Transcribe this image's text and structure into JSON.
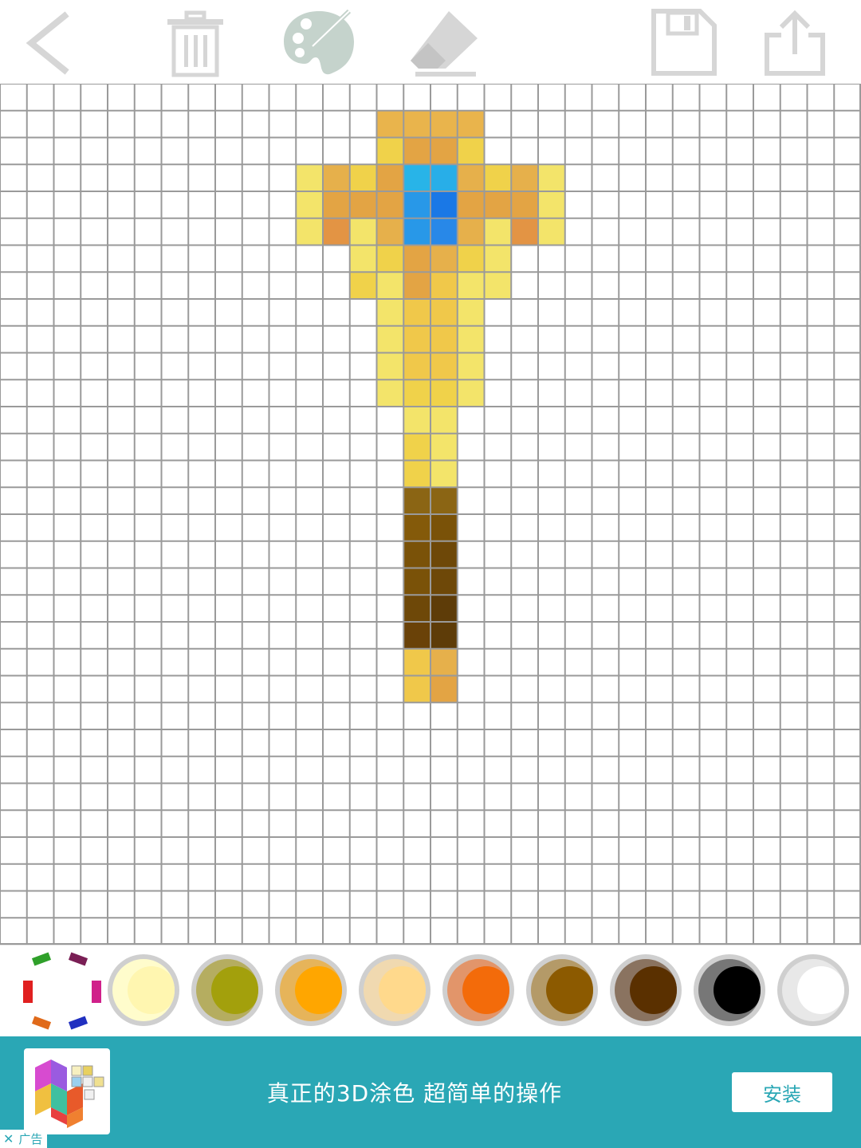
{
  "toolbar": {
    "icons": [
      "back-arrow-icon",
      "trash-icon",
      "palette-icon",
      "eraser-icon",
      "save-icon",
      "share-icon"
    ],
    "icon_color": "#d6d6d6",
    "palette_icon_color": "#c5d3cc"
  },
  "canvas": {
    "grid_cells": 32,
    "grid_color": "#9a9a9a",
    "pixels": [
      [
        14,
        1,
        "#e9b44c"
      ],
      [
        15,
        1,
        "#e9b44c"
      ],
      [
        16,
        1,
        "#e9b44c"
      ],
      [
        17,
        1,
        "#e9b44c"
      ],
      [
        14,
        2,
        "#f0d24a"
      ],
      [
        15,
        2,
        "#e3a444"
      ],
      [
        16,
        2,
        "#e3a444"
      ],
      [
        17,
        2,
        "#f0d24a"
      ],
      [
        11,
        3,
        "#f3e46a"
      ],
      [
        12,
        3,
        "#e6b04b"
      ],
      [
        13,
        3,
        "#f0d24a"
      ],
      [
        14,
        3,
        "#e3a444"
      ],
      [
        15,
        3,
        "#28b4e8"
      ],
      [
        16,
        3,
        "#28aee8"
      ],
      [
        17,
        3,
        "#e6b04b"
      ],
      [
        18,
        3,
        "#f0d24a"
      ],
      [
        19,
        3,
        "#e6b04b"
      ],
      [
        20,
        3,
        "#f3e46a"
      ],
      [
        11,
        4,
        "#f3e46a"
      ],
      [
        12,
        4,
        "#e3a444"
      ],
      [
        13,
        4,
        "#e3a444"
      ],
      [
        14,
        4,
        "#e3a444"
      ],
      [
        15,
        4,
        "#2898e8"
      ],
      [
        16,
        4,
        "#1a78e6"
      ],
      [
        17,
        4,
        "#e3a444"
      ],
      [
        18,
        4,
        "#e3a444"
      ],
      [
        19,
        4,
        "#e3a444"
      ],
      [
        20,
        4,
        "#f3e46a"
      ],
      [
        11,
        5,
        "#f3e46a"
      ],
      [
        12,
        5,
        "#e39444"
      ],
      [
        13,
        5,
        "#f3e46a"
      ],
      [
        14,
        5,
        "#e6b04b"
      ],
      [
        15,
        5,
        "#2898e8"
      ],
      [
        16,
        5,
        "#2888e8"
      ],
      [
        17,
        5,
        "#e6b04b"
      ],
      [
        18,
        5,
        "#f3e46a"
      ],
      [
        19,
        5,
        "#e39444"
      ],
      [
        20,
        5,
        "#f3e46a"
      ],
      [
        13,
        6,
        "#f3e46a"
      ],
      [
        14,
        6,
        "#f0d24a"
      ],
      [
        15,
        6,
        "#e3a444"
      ],
      [
        16,
        6,
        "#e6b04b"
      ],
      [
        17,
        6,
        "#f0d24a"
      ],
      [
        18,
        6,
        "#f3e46a"
      ],
      [
        13,
        7,
        "#f0d24a"
      ],
      [
        14,
        7,
        "#f3e46a"
      ],
      [
        15,
        7,
        "#e3a444"
      ],
      [
        16,
        7,
        "#f0c84a"
      ],
      [
        17,
        7,
        "#f3e46a"
      ],
      [
        18,
        7,
        "#f3e46a"
      ],
      [
        14,
        8,
        "#f3e46a"
      ],
      [
        15,
        8,
        "#f0c84a"
      ],
      [
        16,
        8,
        "#f0c84a"
      ],
      [
        17,
        8,
        "#f3e46a"
      ],
      [
        14,
        9,
        "#f3e46a"
      ],
      [
        15,
        9,
        "#f0c84a"
      ],
      [
        16,
        9,
        "#f0c84a"
      ],
      [
        17,
        9,
        "#f3e46a"
      ],
      [
        14,
        10,
        "#f3e46a"
      ],
      [
        15,
        10,
        "#f0c84a"
      ],
      [
        16,
        10,
        "#f0c84a"
      ],
      [
        17,
        10,
        "#f3e46a"
      ],
      [
        14,
        11,
        "#f3e46a"
      ],
      [
        15,
        11,
        "#f0d24a"
      ],
      [
        16,
        11,
        "#f0d24a"
      ],
      [
        17,
        11,
        "#f3e46a"
      ],
      [
        15,
        12,
        "#f3e46a"
      ],
      [
        16,
        12,
        "#f3e46a"
      ],
      [
        15,
        13,
        "#f0d24a"
      ],
      [
        16,
        13,
        "#f3e46a"
      ],
      [
        15,
        14,
        "#f0d24a"
      ],
      [
        16,
        14,
        "#f3e46a"
      ],
      [
        15,
        15,
        "#8b6514"
      ],
      [
        16,
        15,
        "#8b6514"
      ],
      [
        15,
        16,
        "#845a0a"
      ],
      [
        16,
        16,
        "#7a5208"
      ],
      [
        15,
        17,
        "#7a5208"
      ],
      [
        16,
        17,
        "#6e4808"
      ],
      [
        15,
        18,
        "#7a5208"
      ],
      [
        16,
        18,
        "#6e4808"
      ],
      [
        15,
        19,
        "#6e4808"
      ],
      [
        16,
        19,
        "#5e3c08"
      ],
      [
        15,
        20,
        "#6a4208"
      ],
      [
        16,
        20,
        "#5e3c08"
      ],
      [
        15,
        21,
        "#f0c84a"
      ],
      [
        16,
        21,
        "#e6b04b"
      ],
      [
        15,
        22,
        "#f0c84a"
      ],
      [
        16,
        22,
        "#e3a444"
      ]
    ]
  },
  "palette": {
    "wheel_icon": "color-wheel-icon",
    "swatches": [
      {
        "name": "light-yellow",
        "light": "#fffccc",
        "dark": "#fff6b0"
      },
      {
        "name": "olive",
        "light": "#b5ad60",
        "dark": "#a3a00c"
      },
      {
        "name": "orange",
        "light": "#e6b45a",
        "dark": "#ffa600"
      },
      {
        "name": "peach",
        "light": "#f0d9b0",
        "dark": "#ffd98c"
      },
      {
        "name": "dark-orange",
        "light": "#e2956a",
        "dark": "#f36b0a"
      },
      {
        "name": "brown-gold",
        "light": "#b49a68",
        "dark": "#8c5a00"
      },
      {
        "name": "dark-brown",
        "light": "#8a7360",
        "dark": "#5a3000"
      },
      {
        "name": "black",
        "light": "#777777",
        "dark": "#000000"
      },
      {
        "name": "white",
        "light": "#e8e8e8",
        "dark": "#ffffff"
      }
    ]
  },
  "ad": {
    "text": "真正的3D涂色 超简单的操作",
    "install_label": "安装",
    "tag_label": "广告",
    "close_glyph": "✕",
    "app_icon": "3d-coloring-app-icon",
    "bg_color": "#2aa7b5"
  }
}
